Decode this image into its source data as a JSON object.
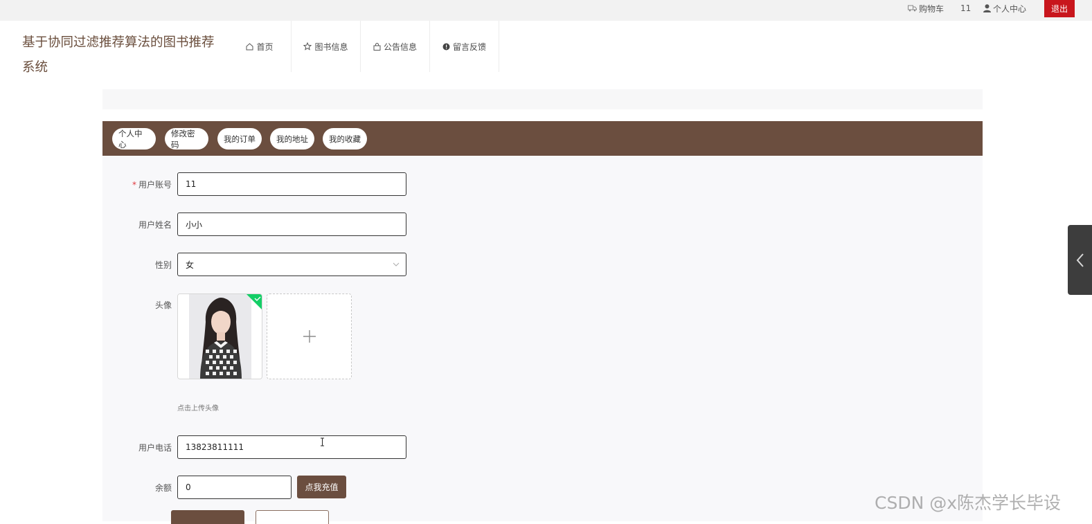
{
  "topbar": {
    "cart_label": "购物车",
    "username": "11",
    "profile_label": "个人中心",
    "logout_label": "退出"
  },
  "site": {
    "title": "基于协同过滤推荐算法的图书推荐系统"
  },
  "nav": {
    "items": [
      {
        "label": "首页",
        "icon": "home-icon"
      },
      {
        "label": "图书信息",
        "icon": "star-icon"
      },
      {
        "label": "公告信息",
        "icon": "bag-icon"
      },
      {
        "label": "留言反馈",
        "icon": "message-icon"
      }
    ]
  },
  "tabs": [
    {
      "label": "个人中心"
    },
    {
      "label": "修改密码"
    },
    {
      "label": "我的订单"
    },
    {
      "label": "我的地址"
    },
    {
      "label": "我的收藏"
    }
  ],
  "form": {
    "account": {
      "label": "用户账号",
      "required_mark": "*",
      "value": "11"
    },
    "name": {
      "label": "用户姓名",
      "value": "小小"
    },
    "gender": {
      "label": "性别",
      "value": "女"
    },
    "avatar": {
      "label": "头像",
      "hint": "点击上传头像"
    },
    "phone": {
      "label": "用户电话",
      "value": "13823811111"
    },
    "balance": {
      "label": "余额",
      "value": "0",
      "recharge_label": "点我充值"
    }
  },
  "watermark": "CSDN @x陈杰学长毕设",
  "colors": {
    "brand_brown": "#6b4e3f",
    "logout_red": "#c8161d",
    "success_green": "#13ce66"
  }
}
